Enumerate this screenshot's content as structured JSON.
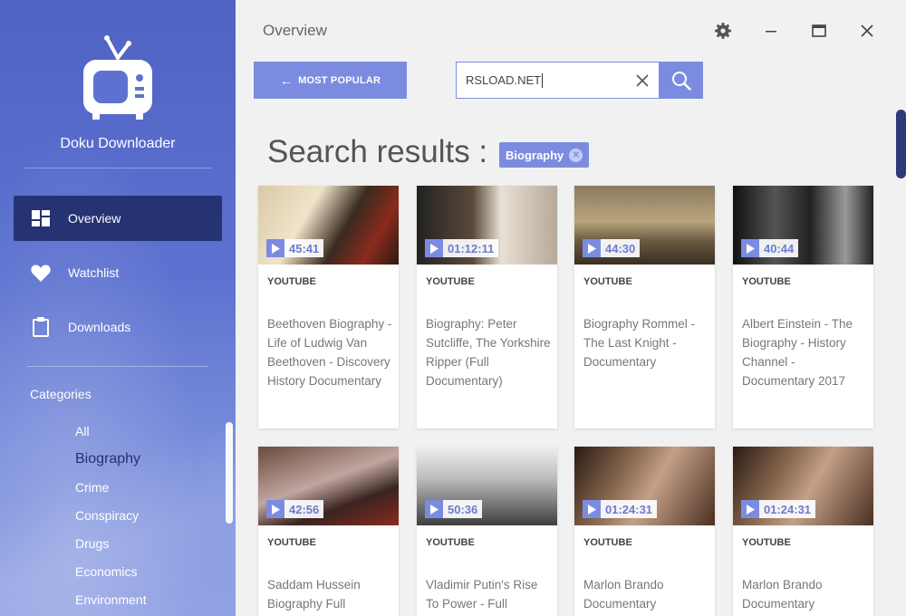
{
  "app": {
    "name": "Doku Downloader"
  },
  "nav": [
    {
      "label": "Overview",
      "icon": "dashboard-icon",
      "active": true
    },
    {
      "label": "Watchlist",
      "icon": "heart-icon",
      "active": false
    },
    {
      "label": "Downloads",
      "icon": "clipboard-icon",
      "active": false
    }
  ],
  "categories": {
    "title": "Categories",
    "items": [
      "All",
      "Biography",
      "Crime",
      "Conspiracy",
      "Drugs",
      "Economics",
      "Environment"
    ],
    "selected": "Biography"
  },
  "header": {
    "title": "Overview"
  },
  "toolbar": {
    "most_popular_label": "MOST POPULAR"
  },
  "search": {
    "value": "RSLOAD.NET"
  },
  "results": {
    "title": "Search results :",
    "tag": "Biography"
  },
  "videos": [
    {
      "duration": "45:41",
      "source": "YOUTUBE",
      "title": "Beethoven Biography - Life of Ludwig Van Beethoven - Discovery History Documentary"
    },
    {
      "duration": "01:12:11",
      "source": "YOUTUBE",
      "title": "Biography: Peter Sutcliffe, The Yorkshire Ripper (Full Documentary)"
    },
    {
      "duration": "44:30",
      "source": "YOUTUBE",
      "title": "Biography Rommel - The Last Knight - Documentary"
    },
    {
      "duration": "40:44",
      "source": "YOUTUBE",
      "title": "Albert Einstein - The Biography - History Channel - Documentary 2017"
    },
    {
      "duration": "42:56",
      "source": "YOUTUBE",
      "title": "Saddam Hussein Biography Full"
    },
    {
      "duration": "50:36",
      "source": "YOUTUBE",
      "title": "Vladimir Putin's Rise To Power - Full"
    },
    {
      "duration": "01:24:31",
      "source": "YOUTUBE",
      "title": "Marlon Brando Documentary"
    },
    {
      "duration": "01:24:31",
      "source": "YOUTUBE",
      "title": "Marlon Brando Documentary"
    }
  ],
  "colors": {
    "accent": "#7b8ce0",
    "sidebar_active": "#263372",
    "scrollbar": "#2c3a7a"
  }
}
